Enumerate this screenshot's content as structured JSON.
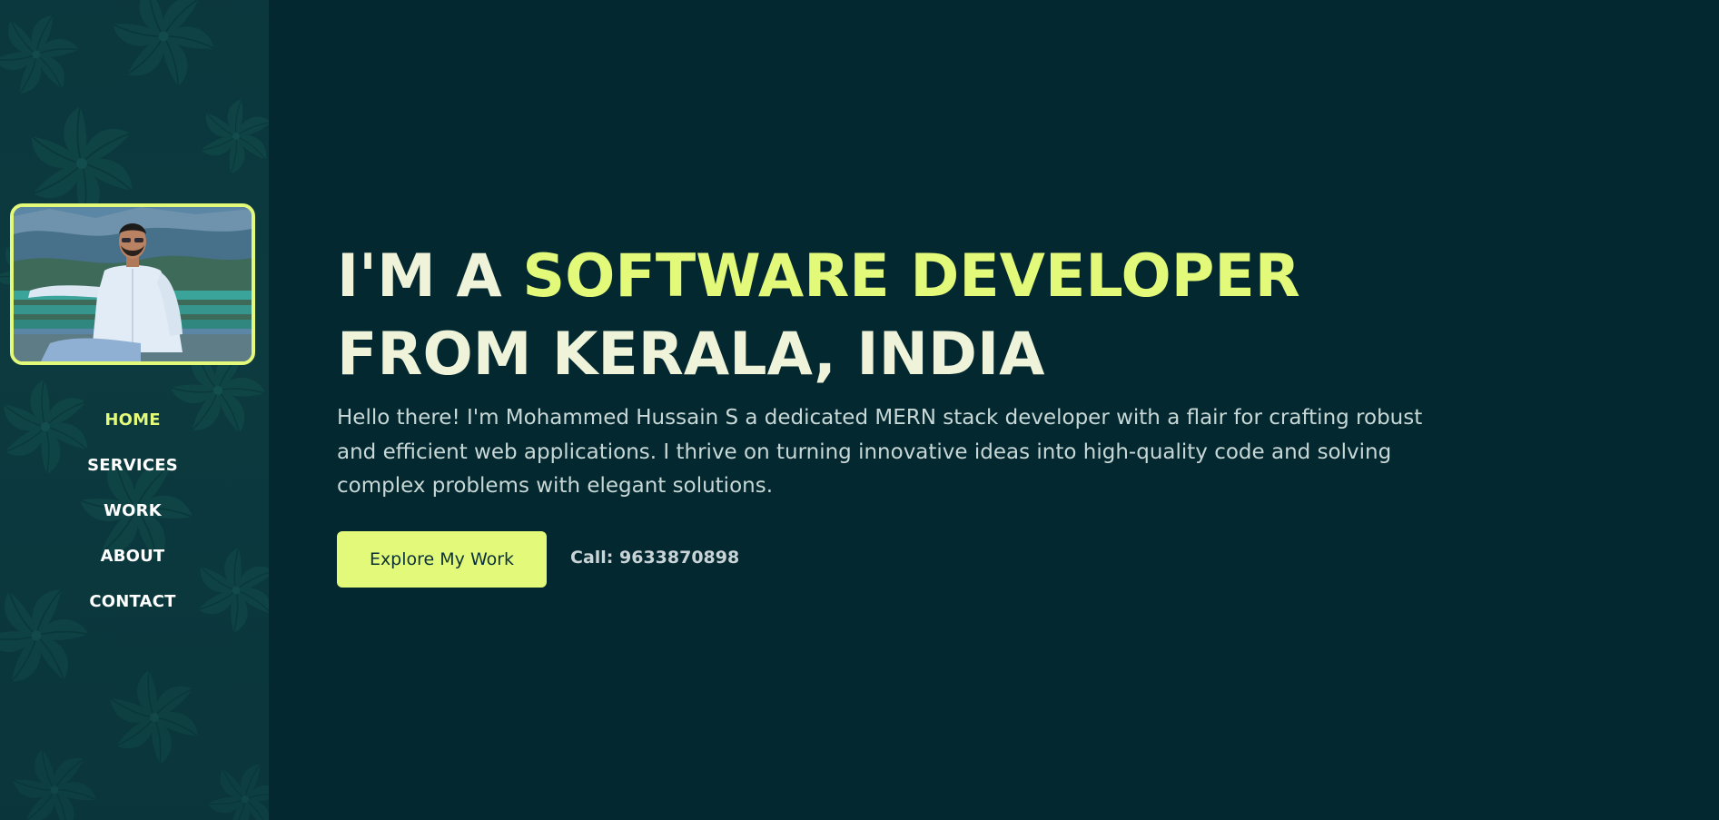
{
  "profile": {
    "photo_alt": "Profile photo"
  },
  "nav": {
    "items": [
      {
        "label": "HOME",
        "active": true
      },
      {
        "label": "SERVICES",
        "active": false
      },
      {
        "label": "WORK",
        "active": false
      },
      {
        "label": "ABOUT",
        "active": false
      },
      {
        "label": "CONTACT",
        "active": false
      }
    ]
  },
  "hero": {
    "title_prefix": "I'M A",
    "title_accent": "SOFTWARE DEVELOPER",
    "title_line2": "FROM KERALA, INDIA",
    "description": "Hello there! I'm Mohammed Hussain S a dedicated MERN stack developer with a flair for crafting robust and efficient web applications. I thrive on turning innovative ideas into high-quality code and solving complex problems with elegant solutions.",
    "cta_label": "Explore My Work",
    "call_text": "Call: 9633870898"
  },
  "colors": {
    "background": "#032830",
    "sidebar": "#0c3a3f",
    "accent": "#e3f97a",
    "title_text": "#eef3d9",
    "body_text": "#c8d8d6"
  }
}
